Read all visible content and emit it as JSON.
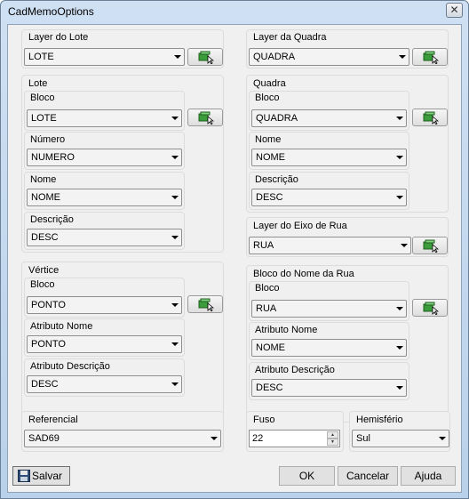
{
  "window": {
    "title": "CadMemoOptions",
    "close_glyph": "✕"
  },
  "layer_lote": {
    "label": "Layer do Lote",
    "value": "LOTE"
  },
  "layer_quadra": {
    "label": "Layer da Quadra",
    "value": "QUADRA"
  },
  "lote": {
    "label": "Lote",
    "bloco_label": "Bloco",
    "bloco_value": "LOTE",
    "numero_label": "Número",
    "numero_value": "NUMERO",
    "nome_label": "Nome",
    "nome_value": "NOME",
    "descricao_label": "Descrição",
    "descricao_value": "DESC"
  },
  "quadra": {
    "label": "Quadra",
    "bloco_label": "Bloco",
    "bloco_value": "QUADRA",
    "nome_label": "Nome",
    "nome_value": "NOME",
    "descricao_label": "Descrição",
    "descricao_value": "DESC"
  },
  "layer_eixo": {
    "label": "Layer do Eixo de Rua",
    "value": "RUA"
  },
  "vertice": {
    "label": "Vértice",
    "bloco_label": "Bloco",
    "bloco_value": "PONTO",
    "atr_nome_label": "Atributo Nome",
    "atr_nome_value": "PONTO",
    "atr_desc_label": "Atributo Descrição",
    "atr_desc_value": "DESC"
  },
  "bloco_rua": {
    "label": "Bloco do Nome da Rua",
    "bloco_label": "Bloco",
    "bloco_value": "RUA",
    "atr_nome_label": "Atributo Nome",
    "atr_nome_value": "NOME",
    "atr_desc_label": "Atributo Descrição",
    "atr_desc_value": "DESC"
  },
  "referencial": {
    "label": "Referencial",
    "value": "SAD69"
  },
  "fuso": {
    "label": "Fuso",
    "value": "22"
  },
  "hemisferio": {
    "label": "Hemisfério",
    "value": "Sul"
  },
  "buttons": {
    "salvar": "Salvar",
    "ok": "OK",
    "cancelar": "Cancelar",
    "ajuda": "Ajuda"
  },
  "icons": {
    "pick": "select-object-icon",
    "save": "floppy-disk-icon"
  }
}
